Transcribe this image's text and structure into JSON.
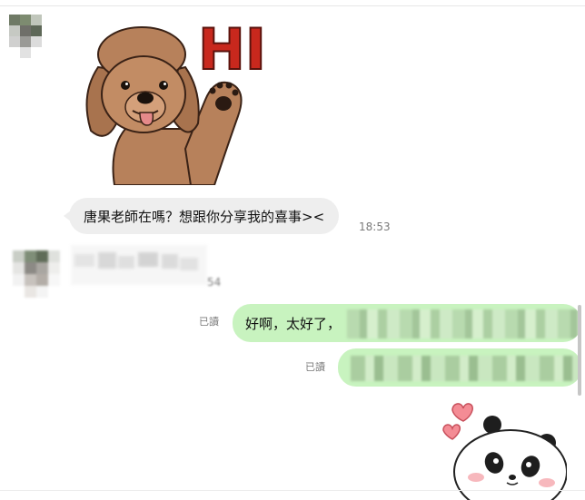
{
  "messages": {
    "incoming_text": "唐果老師在嗎？想跟你分享我的喜事><",
    "incoming_time": "18:53",
    "incoming_blurred_time": "54",
    "outgoing_text": "好啊，太好了，",
    "read_label_1": "已讀",
    "read_label_2": "已讀"
  },
  "stickers": {
    "dog_text": "HI"
  },
  "colors": {
    "incoming_bubble": "#eeeeee",
    "outgoing_bubble": "#c8f3bf",
    "timestamp": "#7b7b7b",
    "sticker_hi_red": "#c8281d"
  }
}
